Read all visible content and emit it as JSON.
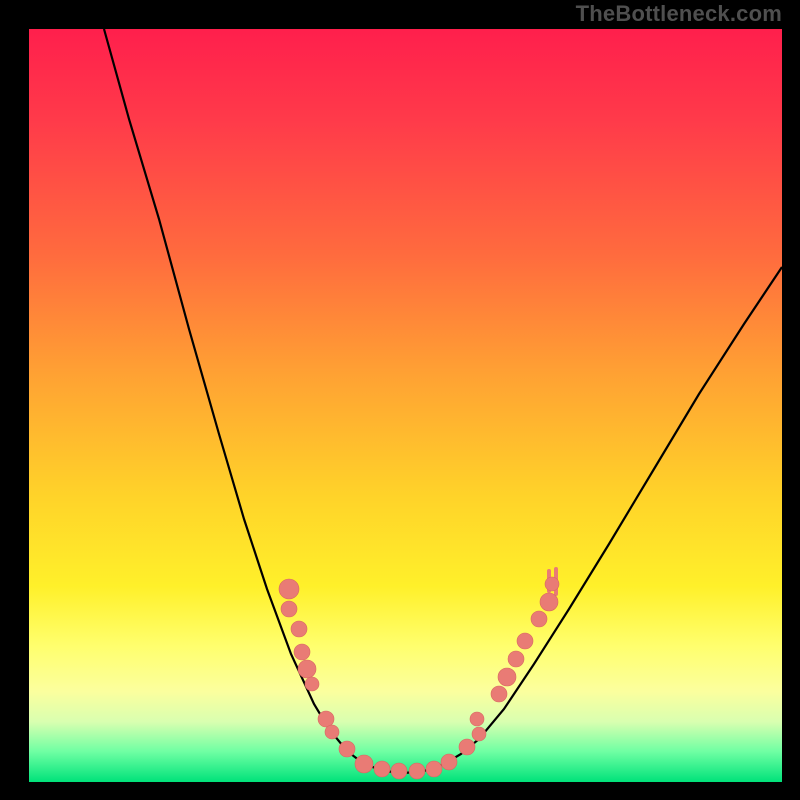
{
  "watermark": "TheBottleneck.com",
  "colors": {
    "dot": "#e97b75",
    "curve": "#000000"
  },
  "chart_data": {
    "type": "line",
    "title": "",
    "xlabel": "",
    "ylabel": "",
    "xlim": [
      0,
      753
    ],
    "ylim": [
      0,
      753
    ],
    "curve": [
      {
        "x": 75,
        "y": 0
      },
      {
        "x": 100,
        "y": 90
      },
      {
        "x": 130,
        "y": 190
      },
      {
        "x": 160,
        "y": 300
      },
      {
        "x": 190,
        "y": 405
      },
      {
        "x": 215,
        "y": 490
      },
      {
        "x": 238,
        "y": 560
      },
      {
        "x": 262,
        "y": 625
      },
      {
        "x": 285,
        "y": 675
      },
      {
        "x": 300,
        "y": 700
      },
      {
        "x": 318,
        "y": 722
      },
      {
        "x": 335,
        "y": 735
      },
      {
        "x": 355,
        "y": 742
      },
      {
        "x": 375,
        "y": 744
      },
      {
        "x": 395,
        "y": 742
      },
      {
        "x": 415,
        "y": 735
      },
      {
        "x": 432,
        "y": 725
      },
      {
        "x": 450,
        "y": 710
      },
      {
        "x": 475,
        "y": 680
      },
      {
        "x": 505,
        "y": 635
      },
      {
        "x": 540,
        "y": 580
      },
      {
        "x": 580,
        "y": 515
      },
      {
        "x": 625,
        "y": 440
      },
      {
        "x": 670,
        "y": 365
      },
      {
        "x": 715,
        "y": 295
      },
      {
        "x": 753,
        "y": 238
      }
    ],
    "dots": [
      {
        "x": 260,
        "y": 560,
        "r": 10
      },
      {
        "x": 260,
        "y": 580,
        "r": 8
      },
      {
        "x": 270,
        "y": 600,
        "r": 8
      },
      {
        "x": 273,
        "y": 623,
        "r": 8
      },
      {
        "x": 278,
        "y": 640,
        "r": 9
      },
      {
        "x": 283,
        "y": 655,
        "r": 7
      },
      {
        "x": 297,
        "y": 690,
        "r": 8
      },
      {
        "x": 303,
        "y": 703,
        "r": 7
      },
      {
        "x": 318,
        "y": 720,
        "r": 8
      },
      {
        "x": 335,
        "y": 735,
        "r": 9
      },
      {
        "x": 353,
        "y": 740,
        "r": 8
      },
      {
        "x": 370,
        "y": 742,
        "r": 8
      },
      {
        "x": 388,
        "y": 742,
        "r": 8
      },
      {
        "x": 405,
        "y": 740,
        "r": 8
      },
      {
        "x": 420,
        "y": 733,
        "r": 8
      },
      {
        "x": 438,
        "y": 718,
        "r": 8
      },
      {
        "x": 450,
        "y": 705,
        "r": 7
      },
      {
        "x": 448,
        "y": 690,
        "r": 7
      },
      {
        "x": 470,
        "y": 665,
        "r": 8
      },
      {
        "x": 478,
        "y": 648,
        "r": 9
      },
      {
        "x": 487,
        "y": 630,
        "r": 8
      },
      {
        "x": 496,
        "y": 612,
        "r": 8
      },
      {
        "x": 510,
        "y": 590,
        "r": 8
      },
      {
        "x": 520,
        "y": 573,
        "r": 9
      },
      {
        "x": 523,
        "y": 555,
        "r": 7
      }
    ],
    "ticks": [
      {
        "x1": 520,
        "y1": 542,
        "x2": 520,
        "y2": 562
      },
      {
        "x1": 527,
        "y1": 540,
        "x2": 527,
        "y2": 565
      }
    ]
  }
}
